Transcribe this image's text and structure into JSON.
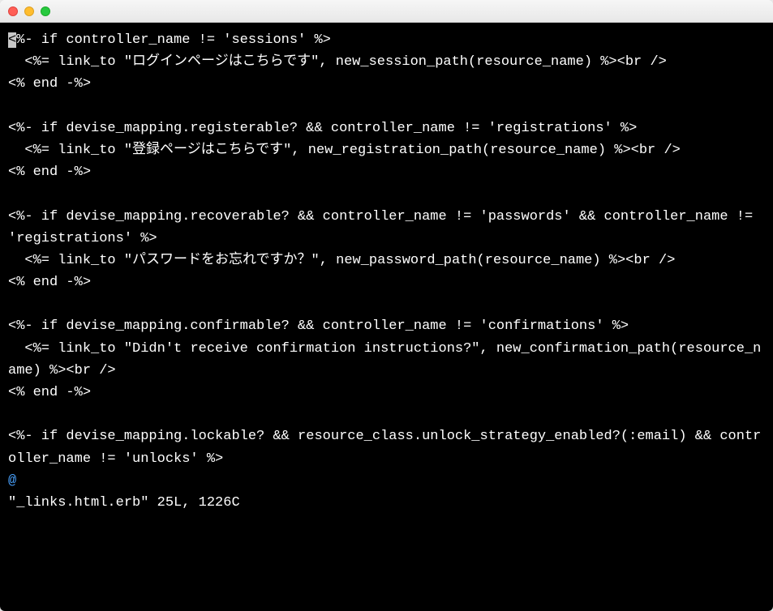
{
  "editor": {
    "mode_indicator": "@",
    "status_line": "\"_links.html.erb\" 25L, 1226C",
    "lines": [
      "<%- if controller_name != 'sessions' %>",
      "  <%= link_to \"ログインページはこちらです\", new_session_path(resource_name) %><br />",
      "<% end -%>",
      "",
      "<%- if devise_mapping.registerable? && controller_name != 'registrations' %>",
      "  <%= link_to \"登録ページはこちらです\", new_registration_path(resource_name) %><br />",
      "<% end -%>",
      "",
      "<%- if devise_mapping.recoverable? && controller_name != 'passwords' && controller_name != 'registrations' %>",
      "  <%= link_to \"パスワードをお忘れですか？\", new_password_path(resource_name) %><br />",
      "<% end -%>",
      "",
      "<%- if devise_mapping.confirmable? && controller_name != 'confirmations' %>",
      "  <%= link_to \"Didn't receive confirmation instructions?\", new_confirmation_path(resource_name) %><br />",
      "<% end -%>",
      "",
      "<%- if devise_mapping.lockable? && resource_class.unlock_strategy_enabled?(:email) && controller_name != 'unlocks' %>"
    ]
  }
}
